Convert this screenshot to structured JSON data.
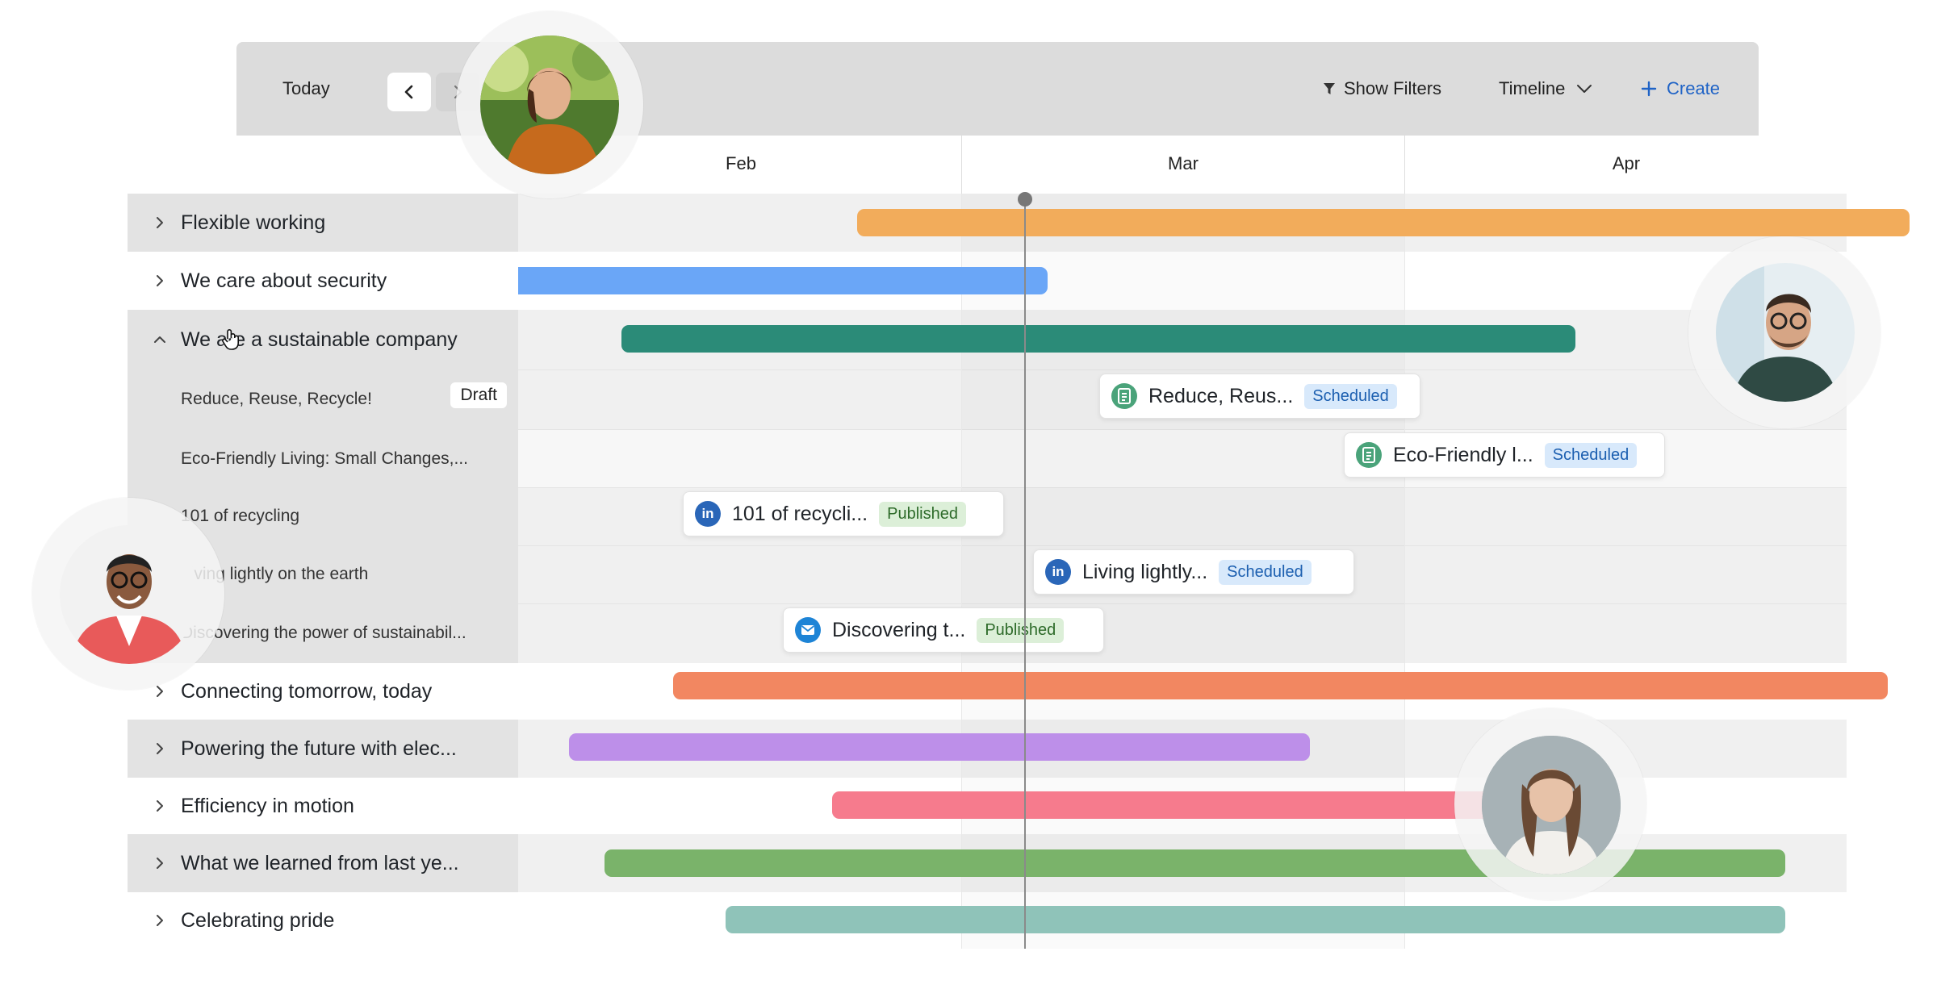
{
  "toolbar": {
    "today_label": "Today",
    "show_filters_label": "Show Filters",
    "view_label": "Timeline",
    "create_label": "Create",
    "accent": "#1f63c6"
  },
  "months": [
    "Feb",
    "Mar",
    "Apr"
  ],
  "rows": [
    {
      "label": "Flexible working",
      "bar_color": "#f2ac5b"
    },
    {
      "label": "We care about security",
      "bar_color": "#6aa6f7"
    },
    {
      "label": "We are a sustainable company",
      "bar_color": "#2b8b78"
    },
    {
      "label": "Reduce, Reuse, Recycle!",
      "tag": "Draft",
      "card_title": "Reduce, Reus...",
      "card_status": "Scheduled",
      "channel": "document-icon"
    },
    {
      "label": "Eco-Friendly Living: Small Changes,...",
      "card_title": "Eco-Friendly l...",
      "card_status": "Scheduled",
      "channel": "document-icon"
    },
    {
      "label": "101 of recycling",
      "card_title": "101 of recycli...",
      "card_status": "Published",
      "channel": "linkedin-icon"
    },
    {
      "label": "Living lightly on the earth",
      "card_title": "Living lightly...",
      "card_status": "Scheduled",
      "channel": "linkedin-icon"
    },
    {
      "label": "Discovering the power of sustainabil...",
      "card_title": "Discovering t...",
      "card_status": "Published",
      "channel": "email-icon"
    },
    {
      "label": "Connecting tomorrow, today",
      "bar_color": "#f28761"
    },
    {
      "label": "Powering the future with elec...",
      "bar_color": "#bd8fe9"
    },
    {
      "label": "Efficiency in motion",
      "bar_color": "#f67b8d"
    },
    {
      "label": "What we learned from last ye...",
      "bar_color": "#7ab36a"
    },
    {
      "label": "Celebrating pride",
      "bar_color": "#8fc3b9"
    }
  ]
}
